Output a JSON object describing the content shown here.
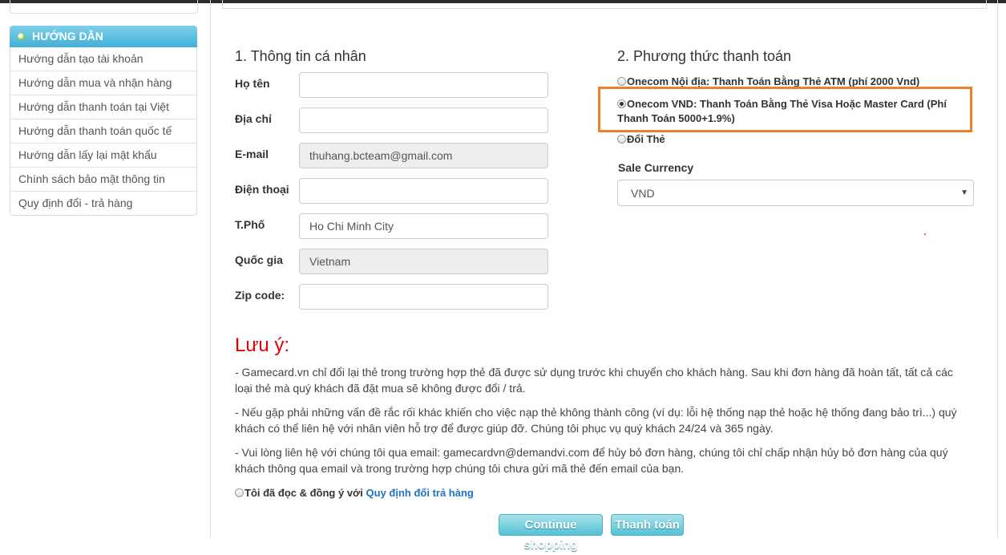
{
  "sidebar": {
    "title": "HƯỚNG DẪN",
    "items": [
      {
        "label": "Hướng dẫn tạo tài khoản"
      },
      {
        "label": "Hướng dẫn mua và nhận hàng"
      },
      {
        "label": "Hướng dẫn thanh toán tại Việt"
      },
      {
        "label": "Hướng dẫn thanh toán quốc tế"
      },
      {
        "label": "Hướng dẫn lấy lại mật khẩu"
      },
      {
        "label": "Chính sách bảo mật thông tin"
      },
      {
        "label": "Quy định đổi - trả hàng"
      }
    ]
  },
  "personal": {
    "title": "1. Thông tin cá nhân",
    "fields": [
      {
        "label": "Họ tên",
        "value": ""
      },
      {
        "label": "Địa chỉ",
        "value": ""
      },
      {
        "label": "E-mail",
        "value": "thuhang.bcteam@gmail.com"
      },
      {
        "label": "Điện thoại",
        "value": ""
      },
      {
        "label": "T.Phố",
        "value": "Ho Chi Minh City"
      },
      {
        "label": "Quốc gia",
        "value": "Vietnam"
      },
      {
        "label": "Zip code:",
        "value": ""
      }
    ]
  },
  "payment": {
    "title": "2. Phương thức thanh toán",
    "options": [
      {
        "label": "Onecom Nội địa: Thanh Toán Bằng Thẻ ATM (phí 2000 Vnd)",
        "checked": false
      },
      {
        "label_line1": "Onecom VND: Thanh Toán Bằng Thẻ Visa Hoặc Master Card (Phí",
        "label_line2": "Thanh Toán 5000+1.9%)",
        "checked": true
      },
      {
        "label": "Đổi Thẻ",
        "checked": false
      }
    ],
    "highlight_color": "#ee7f2d",
    "currency_label": "Sale Currency",
    "currency_value": "VND"
  },
  "note": {
    "title": "Lưu ý:",
    "p1_line1": "- Gamecard.vn chỉ đổi lại thẻ trong trường hợp thẻ đã được sử dụng trước khi chuyển cho khách hàng. Sau khi đơn hàng đã hoàn tất, tất cả các",
    "p1_line2": "loại thẻ mà quý khách đã đặt mua sẽ không được đổi / trả.",
    "p2_line1": "- Nếu gặp phải những vấn đề rắc rối khác khiến cho việc nạp thẻ không thành công (ví dụ: lỗi hệ thống nạp thẻ hoặc hệ thống đang bảo trì...) quý",
    "p2_line2": "khách có thể liên hệ với nhân viên hỗ trợ để được giúp đỡ. Chúng tôi phục vụ quý khách 24/24 và 365 ngày.",
    "p3_line1": "- Vui lòng liên hệ với chúng tôi qua email: gamecardvn@demandvi.com để hủy bỏ đơn hàng, chúng tôi chỉ chấp nhận hủy bỏ đơn hàng của quý",
    "p3_line2": "khách thông qua email và trong trường hợp chúng tôi chưa gửi mã thẻ đến email của bạn."
  },
  "agree": {
    "text": "Tôi đã đọc & đồng ý với ",
    "link": "Quy định đổi trả hàng"
  },
  "buttons": {
    "continue": "Continue shopping",
    "pay": "Thanh toán"
  }
}
